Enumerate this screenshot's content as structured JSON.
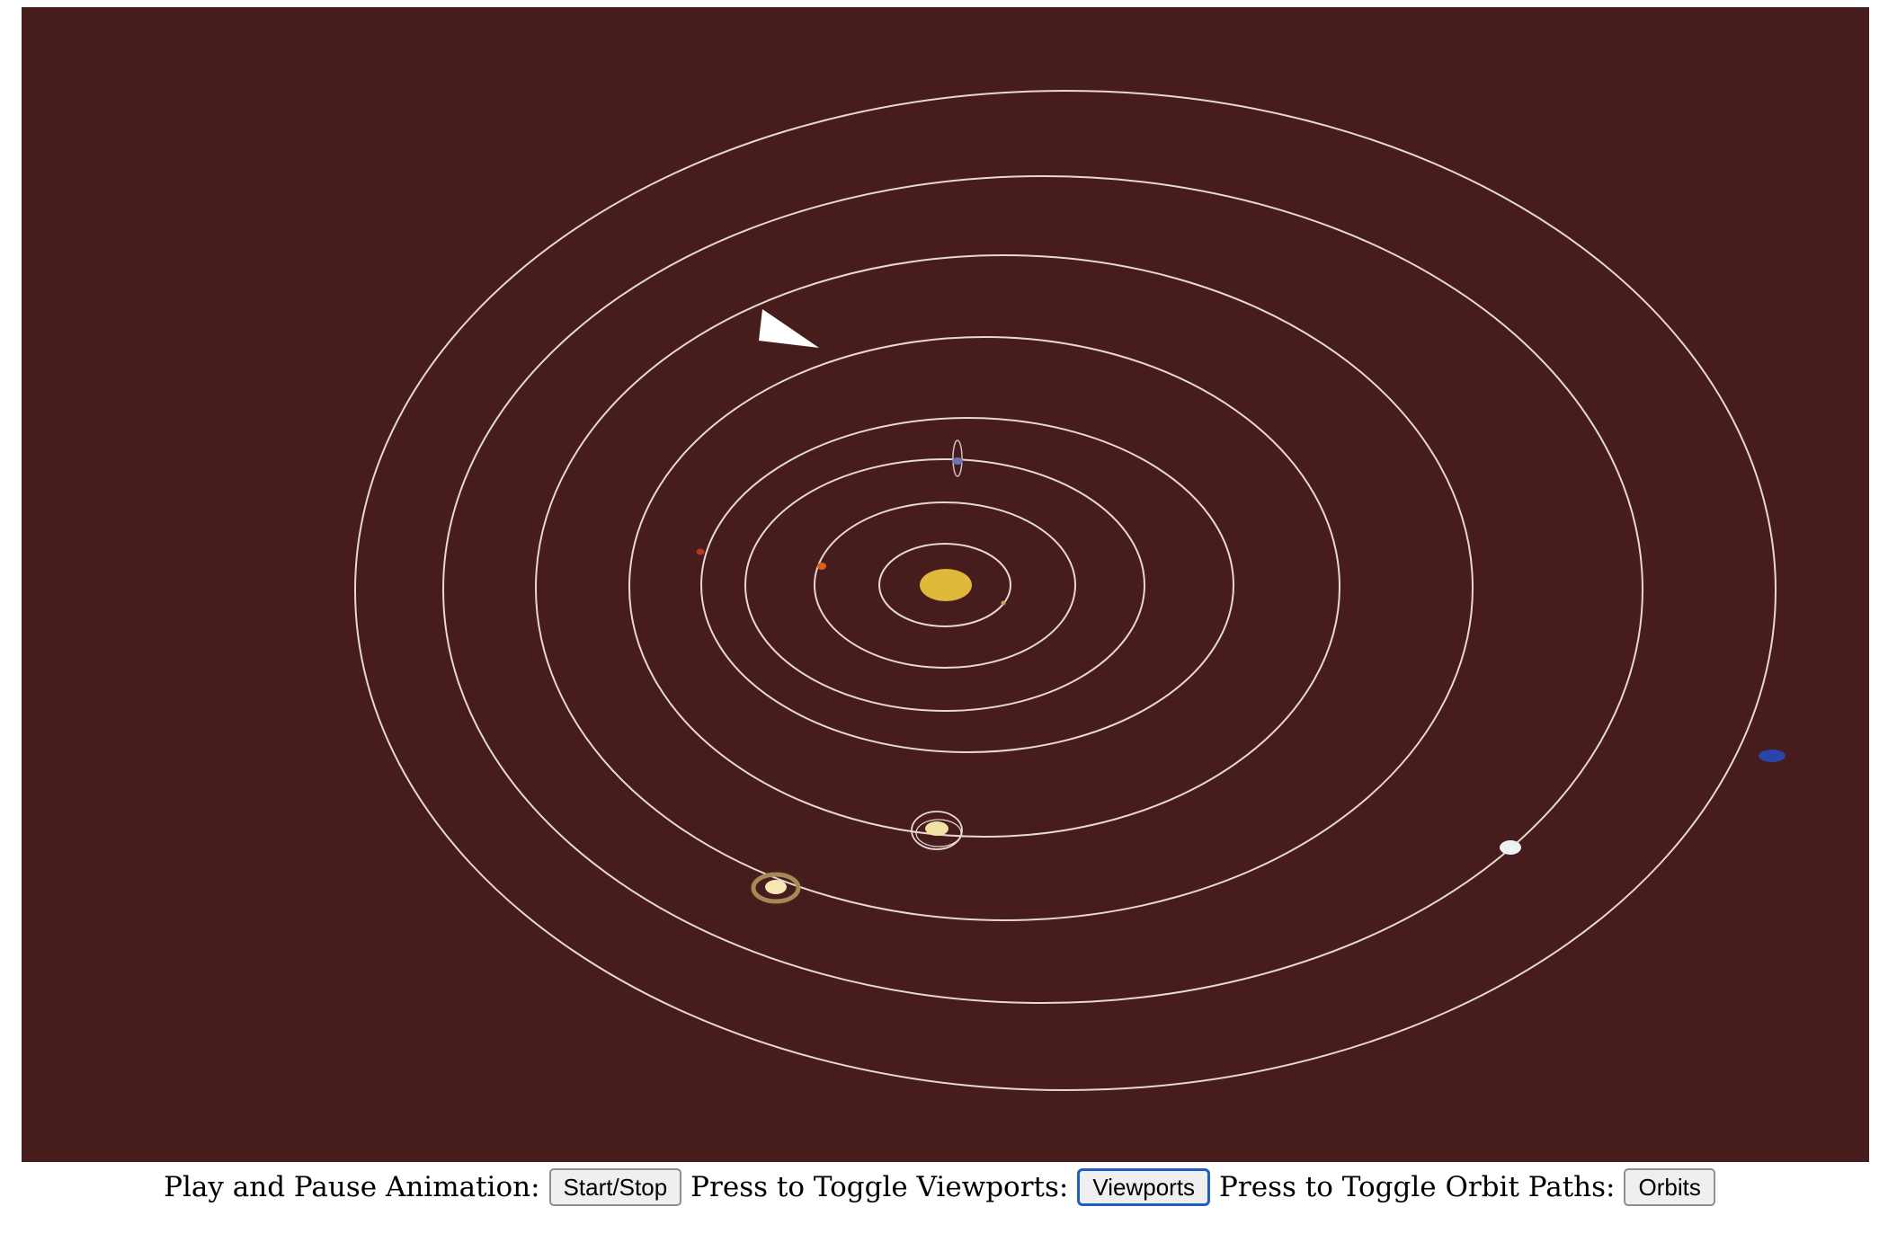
{
  "scene": {
    "background": "#461c1c",
    "orbit_color": "#e6d8d2",
    "sun_color": "#e0b83a",
    "bodies": [
      {
        "name": "sun",
        "icon": "sun-icon",
        "color": "#e0b83a"
      },
      {
        "name": "mercury",
        "icon": "planet-icon",
        "color": "#c9a64a"
      },
      {
        "name": "venus",
        "icon": "planet-icon",
        "color": "#d9601e"
      },
      {
        "name": "earth",
        "icon": "planet-with-moon-icon",
        "color": "#6d74b3"
      },
      {
        "name": "mars",
        "icon": "planet-icon",
        "color": "#b8341e"
      },
      {
        "name": "jupiter",
        "icon": "planet-with-moons-icon",
        "color": "#f1e2a4"
      },
      {
        "name": "saturn",
        "icon": "ringed-planet-icon",
        "color": "#f4e7b0"
      },
      {
        "name": "uranus",
        "icon": "planet-icon",
        "color": "#eef2f3"
      },
      {
        "name": "neptune",
        "icon": "planet-icon",
        "color": "#2a44a8"
      }
    ],
    "marker_icon": "white-triangle-icon"
  },
  "controls": {
    "play_label": "Play and Pause Animation:",
    "play_button": "Start/Stop",
    "viewports_label": "Press to Toggle Viewports:",
    "viewports_button": "Viewports",
    "orbits_label": "Press to Toggle Orbit Paths:",
    "orbits_button": "Orbits"
  }
}
